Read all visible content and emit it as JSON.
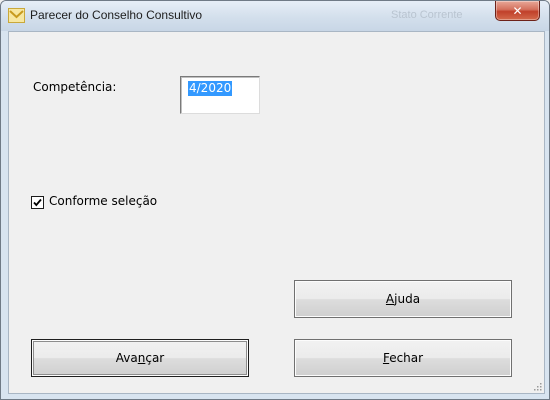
{
  "window": {
    "title": "Parecer do Conselho Consultivo",
    "background_window_text": "Stato Corrente",
    "close_glyph": "✕"
  },
  "form": {
    "competencia_label": "Competência:",
    "competencia_value": "4/2020",
    "conforme_label": "Conforme seleção",
    "conforme_checked": true
  },
  "buttons": {
    "ajuda": {
      "pre": "",
      "key": "A",
      "post": "juda"
    },
    "avancar": {
      "pre": "Ava",
      "key": "n",
      "post": "çar"
    },
    "fechar": {
      "pre": "",
      "key": "F",
      "post": "echar"
    }
  },
  "colors": {
    "selection": "#3399ff",
    "close_button": "#c0402a"
  }
}
